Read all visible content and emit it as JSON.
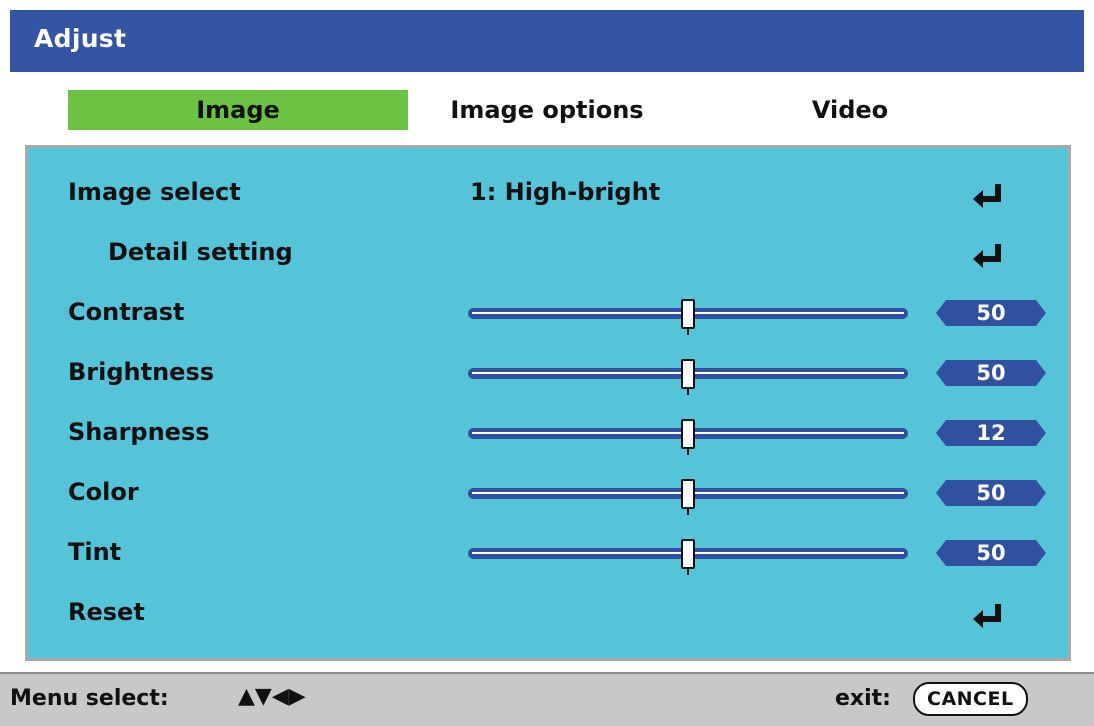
{
  "window": {
    "title": "Adjust"
  },
  "tabs": [
    {
      "label": "Image",
      "active": true
    },
    {
      "label": "Image options",
      "active": false
    },
    {
      "label": "Video",
      "active": false
    }
  ],
  "rows": {
    "image_select": {
      "label": "Image select",
      "value": "1: High-bright",
      "icon": "enter-icon"
    },
    "detail_setting": {
      "label": "Detail setting",
      "icon": "enter-icon"
    },
    "contrast": {
      "label": "Contrast",
      "value": "50",
      "level": 0.5
    },
    "brightness": {
      "label": "Brightness",
      "value": "50",
      "level": 0.5
    },
    "sharpness": {
      "label": "Sharpness",
      "value": "12",
      "level": 0.5
    },
    "color": {
      "label": "Color",
      "value": "50",
      "level": 0.5
    },
    "tint": {
      "label": "Tint",
      "value": "50",
      "level": 0.5
    },
    "reset": {
      "label": "Reset",
      "icon": "enter-icon"
    }
  },
  "footer": {
    "menu_select": "Menu select:",
    "arrows": "▲▼◀▶",
    "exit": "exit:",
    "cancel": "CANCEL"
  },
  "colors": {
    "title_bar": "#3455a4",
    "active_tab": "#6cc343",
    "panel": "#55c4d9",
    "slider": "#3150a0",
    "footer": "#c8c8c8"
  }
}
